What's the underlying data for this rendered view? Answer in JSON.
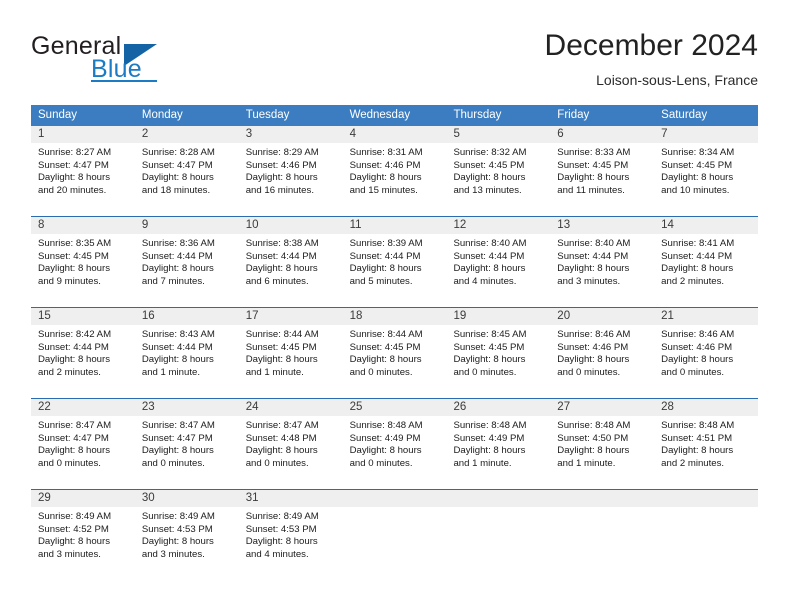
{
  "brand": {
    "name_part1": "General",
    "name_part2": "Blue",
    "logo_icon": "triangle-logo-icon"
  },
  "header": {
    "title": "December 2024",
    "subtitle": "Loison-sous-Lens, France"
  },
  "calendar": {
    "weekdays": [
      "Sunday",
      "Monday",
      "Tuesday",
      "Wednesday",
      "Thursday",
      "Friday",
      "Saturday"
    ],
    "colors": {
      "header_blue": "#3b7dc0",
      "row_divider_blue": "#2b6cb0",
      "day_number_band": "#efefef",
      "brand_blue": "#1b7bc4"
    },
    "weeks": [
      {
        "days": [
          {
            "number": "1",
            "sunrise": "Sunrise: 8:27 AM",
            "sunset": "Sunset: 4:47 PM",
            "daylight_line1": "Daylight: 8 hours",
            "daylight_line2": "and 20 minutes."
          },
          {
            "number": "2",
            "sunrise": "Sunrise: 8:28 AM",
            "sunset": "Sunset: 4:47 PM",
            "daylight_line1": "Daylight: 8 hours",
            "daylight_line2": "and 18 minutes."
          },
          {
            "number": "3",
            "sunrise": "Sunrise: 8:29 AM",
            "sunset": "Sunset: 4:46 PM",
            "daylight_line1": "Daylight: 8 hours",
            "daylight_line2": "and 16 minutes."
          },
          {
            "number": "4",
            "sunrise": "Sunrise: 8:31 AM",
            "sunset": "Sunset: 4:46 PM",
            "daylight_line1": "Daylight: 8 hours",
            "daylight_line2": "and 15 minutes."
          },
          {
            "number": "5",
            "sunrise": "Sunrise: 8:32 AM",
            "sunset": "Sunset: 4:45 PM",
            "daylight_line1": "Daylight: 8 hours",
            "daylight_line2": "and 13 minutes."
          },
          {
            "number": "6",
            "sunrise": "Sunrise: 8:33 AM",
            "sunset": "Sunset: 4:45 PM",
            "daylight_line1": "Daylight: 8 hours",
            "daylight_line2": "and 11 minutes."
          },
          {
            "number": "7",
            "sunrise": "Sunrise: 8:34 AM",
            "sunset": "Sunset: 4:45 PM",
            "daylight_line1": "Daylight: 8 hours",
            "daylight_line2": "and 10 minutes."
          }
        ]
      },
      {
        "days": [
          {
            "number": "8",
            "sunrise": "Sunrise: 8:35 AM",
            "sunset": "Sunset: 4:45 PM",
            "daylight_line1": "Daylight: 8 hours",
            "daylight_line2": "and 9 minutes."
          },
          {
            "number": "9",
            "sunrise": "Sunrise: 8:36 AM",
            "sunset": "Sunset: 4:44 PM",
            "daylight_line1": "Daylight: 8 hours",
            "daylight_line2": "and 7 minutes."
          },
          {
            "number": "10",
            "sunrise": "Sunrise: 8:38 AM",
            "sunset": "Sunset: 4:44 PM",
            "daylight_line1": "Daylight: 8 hours",
            "daylight_line2": "and 6 minutes."
          },
          {
            "number": "11",
            "sunrise": "Sunrise: 8:39 AM",
            "sunset": "Sunset: 4:44 PM",
            "daylight_line1": "Daylight: 8 hours",
            "daylight_line2": "and 5 minutes."
          },
          {
            "number": "12",
            "sunrise": "Sunrise: 8:40 AM",
            "sunset": "Sunset: 4:44 PM",
            "daylight_line1": "Daylight: 8 hours",
            "daylight_line2": "and 4 minutes."
          },
          {
            "number": "13",
            "sunrise": "Sunrise: 8:40 AM",
            "sunset": "Sunset: 4:44 PM",
            "daylight_line1": "Daylight: 8 hours",
            "daylight_line2": "and 3 minutes."
          },
          {
            "number": "14",
            "sunrise": "Sunrise: 8:41 AM",
            "sunset": "Sunset: 4:44 PM",
            "daylight_line1": "Daylight: 8 hours",
            "daylight_line2": "and 2 minutes."
          }
        ]
      },
      {
        "days": [
          {
            "number": "15",
            "sunrise": "Sunrise: 8:42 AM",
            "sunset": "Sunset: 4:44 PM",
            "daylight_line1": "Daylight: 8 hours",
            "daylight_line2": "and 2 minutes."
          },
          {
            "number": "16",
            "sunrise": "Sunrise: 8:43 AM",
            "sunset": "Sunset: 4:44 PM",
            "daylight_line1": "Daylight: 8 hours",
            "daylight_line2": "and 1 minute."
          },
          {
            "number": "17",
            "sunrise": "Sunrise: 8:44 AM",
            "sunset": "Sunset: 4:45 PM",
            "daylight_line1": "Daylight: 8 hours",
            "daylight_line2": "and 1 minute."
          },
          {
            "number": "18",
            "sunrise": "Sunrise: 8:44 AM",
            "sunset": "Sunset: 4:45 PM",
            "daylight_line1": "Daylight: 8 hours",
            "daylight_line2": "and 0 minutes."
          },
          {
            "number": "19",
            "sunrise": "Sunrise: 8:45 AM",
            "sunset": "Sunset: 4:45 PM",
            "daylight_line1": "Daylight: 8 hours",
            "daylight_line2": "and 0 minutes."
          },
          {
            "number": "20",
            "sunrise": "Sunrise: 8:46 AM",
            "sunset": "Sunset: 4:46 PM",
            "daylight_line1": "Daylight: 8 hours",
            "daylight_line2": "and 0 minutes."
          },
          {
            "number": "21",
            "sunrise": "Sunrise: 8:46 AM",
            "sunset": "Sunset: 4:46 PM",
            "daylight_line1": "Daylight: 8 hours",
            "daylight_line2": "and 0 minutes."
          }
        ]
      },
      {
        "days": [
          {
            "number": "22",
            "sunrise": "Sunrise: 8:47 AM",
            "sunset": "Sunset: 4:47 PM",
            "daylight_line1": "Daylight: 8 hours",
            "daylight_line2": "and 0 minutes."
          },
          {
            "number": "23",
            "sunrise": "Sunrise: 8:47 AM",
            "sunset": "Sunset: 4:47 PM",
            "daylight_line1": "Daylight: 8 hours",
            "daylight_line2": "and 0 minutes."
          },
          {
            "number": "24",
            "sunrise": "Sunrise: 8:47 AM",
            "sunset": "Sunset: 4:48 PM",
            "daylight_line1": "Daylight: 8 hours",
            "daylight_line2": "and 0 minutes."
          },
          {
            "number": "25",
            "sunrise": "Sunrise: 8:48 AM",
            "sunset": "Sunset: 4:49 PM",
            "daylight_line1": "Daylight: 8 hours",
            "daylight_line2": "and 0 minutes."
          },
          {
            "number": "26",
            "sunrise": "Sunrise: 8:48 AM",
            "sunset": "Sunset: 4:49 PM",
            "daylight_line1": "Daylight: 8 hours",
            "daylight_line2": "and 1 minute."
          },
          {
            "number": "27",
            "sunrise": "Sunrise: 8:48 AM",
            "sunset": "Sunset: 4:50 PM",
            "daylight_line1": "Daylight: 8 hours",
            "daylight_line2": "and 1 minute."
          },
          {
            "number": "28",
            "sunrise": "Sunrise: 8:48 AM",
            "sunset": "Sunset: 4:51 PM",
            "daylight_line1": "Daylight: 8 hours",
            "daylight_line2": "and 2 minutes."
          }
        ]
      },
      {
        "days": [
          {
            "number": "29",
            "sunrise": "Sunrise: 8:49 AM",
            "sunset": "Sunset: 4:52 PM",
            "daylight_line1": "Daylight: 8 hours",
            "daylight_line2": "and 3 minutes."
          },
          {
            "number": "30",
            "sunrise": "Sunrise: 8:49 AM",
            "sunset": "Sunset: 4:53 PM",
            "daylight_line1": "Daylight: 8 hours",
            "daylight_line2": "and 3 minutes."
          },
          {
            "number": "31",
            "sunrise": "Sunrise: 8:49 AM",
            "sunset": "Sunset: 4:53 PM",
            "daylight_line1": "Daylight: 8 hours",
            "daylight_line2": "and 4 minutes."
          },
          {
            "number": "",
            "sunrise": "",
            "sunset": "",
            "daylight_line1": "",
            "daylight_line2": "",
            "empty": true
          },
          {
            "number": "",
            "sunrise": "",
            "sunset": "",
            "daylight_line1": "",
            "daylight_line2": "",
            "empty": true
          },
          {
            "number": "",
            "sunrise": "",
            "sunset": "",
            "daylight_line1": "",
            "daylight_line2": "",
            "empty": true
          },
          {
            "number": "",
            "sunrise": "",
            "sunset": "",
            "daylight_line1": "",
            "daylight_line2": "",
            "empty": true
          }
        ]
      }
    ]
  }
}
